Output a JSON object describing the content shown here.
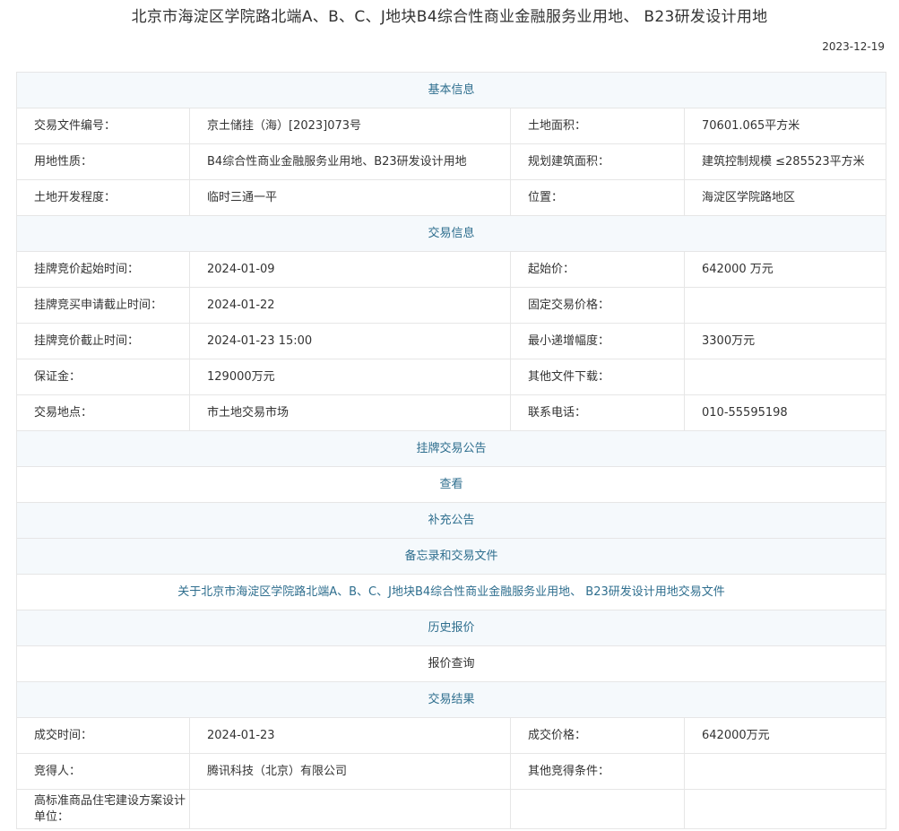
{
  "page": {
    "title": "北京市海淀区学院路北端A、B、C、J地块B4综合性商业金融服务业用地、 B23研发设计用地",
    "date": "2023-12-19"
  },
  "sections": {
    "basic": "基本信息",
    "trade": "交易信息",
    "notice": "挂牌交易公告",
    "supplement": "补充公告",
    "memo": "备忘录和交易文件",
    "history": "历史报价",
    "result": "交易结果"
  },
  "basic": {
    "file_no_label": "交易文件编号：",
    "file_no": "京土储挂（海）[2023]073号",
    "area_label": "土地面积：",
    "area": "70601.065平方米",
    "use_label": "用地性质：",
    "use": "B4综合性商业金融服务业用地、B23研发设计用地",
    "build_area_label": "规划建筑面积：",
    "build_area": "建筑控制规模 ≤285523平方米",
    "dev_label": "土地开发程度：",
    "dev": "临时三通一平",
    "location_label": "位置：",
    "location": "海淀区学院路地区"
  },
  "trade": {
    "start_label": "挂牌竞价起始时间：",
    "start": "2024-01-09",
    "start_price_label": "起始价：",
    "start_price": "642000 万元",
    "apply_deadline_label": "挂牌竞买申请截止时间：",
    "apply_deadline": "2024-01-22",
    "fixed_price_label": "固定交易价格：",
    "fixed_price": "",
    "bid_deadline_label": "挂牌竞价截止时间：",
    "bid_deadline": "2024-01-23 15:00",
    "min_step_label": "最小递增幅度：",
    "min_step": "3300万元",
    "deposit_label": "保证金：",
    "deposit": "129000万元",
    "other_files_label": "其他文件下载：",
    "other_files": "",
    "place_label": "交易地点：",
    "place": "市土地交易市场",
    "phone_label": "联系电话：",
    "phone": "010-55595198"
  },
  "notice": {
    "view_link": "查看"
  },
  "memo": {
    "file_link": "关于北京市海淀区学院路北端A、B、C、J地块B4综合性商业金融服务业用地、 B23研发设计用地交易文件"
  },
  "history": {
    "query_link": "报价查询"
  },
  "result": {
    "deal_time_label": "成交时间：",
    "deal_time": "2024-01-23",
    "deal_price_label": "成交价格：",
    "deal_price": "642000万元",
    "winner_label": "竞得人：",
    "winner": "腾讯科技（北京）有限公司",
    "other_cond_label": "其他竞得条件：",
    "other_cond": "",
    "design_unit_label": "高标准商品住宅建设方案设计单位：",
    "design_unit": ""
  }
}
